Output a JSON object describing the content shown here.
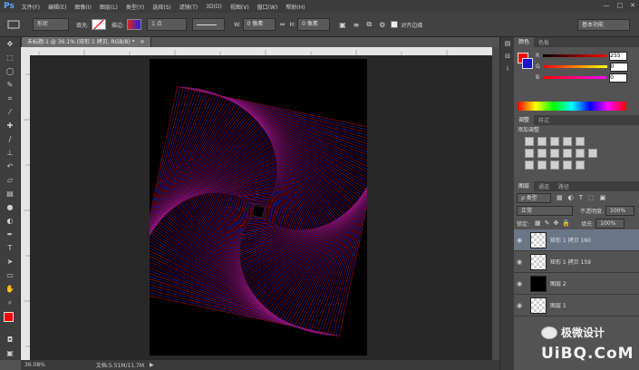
{
  "app": {
    "logo": "Ps"
  },
  "menu": [
    "文件(F)",
    "编辑(E)",
    "图像(I)",
    "图层(L)",
    "类型(Y)",
    "选择(S)",
    "滤镜(T)",
    "3D(D)",
    "视图(V)",
    "窗口(W)",
    "帮助(H)"
  ],
  "window_controls": {
    "minimize": "—",
    "maximize": "□",
    "close": "✕"
  },
  "options": {
    "shape_mode": "形状",
    "fill_label": "填充:",
    "stroke_label": "描边:",
    "stroke_width": "1 点",
    "w_label": "W:",
    "w_value": "0 像素",
    "link_icon": "link-icon",
    "h_label": "H:",
    "h_value": "0 像素",
    "align_edges_label": "对齐边缘",
    "workspace": "基本功能"
  },
  "document": {
    "tab_title": "未标题-1 @ 36.1% (矩形 1 拷贝, RGB/8) *",
    "close": "✕"
  },
  "status": {
    "zoom": "36.08%",
    "doc_info": "文档:5.51M/11.7M"
  },
  "color_panel": {
    "tabs": [
      "颜色",
      "色板"
    ],
    "r_label": "R",
    "r_value": "255",
    "g_label": "G",
    "g_value": "0",
    "b_label": "B",
    "b_value": "0",
    "fg_color": "#ff0000",
    "bg_color": "#1010cc"
  },
  "adjust_panel": {
    "tabs": [
      "调整",
      "样式"
    ],
    "heading": "添加调整"
  },
  "layers_panel": {
    "tabs": [
      "图层",
      "通道",
      "路径"
    ],
    "filter_label": "ρ 类型",
    "blend_mode": "正常",
    "opacity_label": "不透明度:",
    "opacity_value": "100%",
    "lock_label": "锁定:",
    "fill_label": "填充:",
    "fill_value": "100%",
    "layers": [
      {
        "name": "矩形 1 拷贝 160",
        "selected": true
      },
      {
        "name": "矩形 1 拷贝 159",
        "selected": false
      },
      {
        "name": "图层 2",
        "selected": false
      },
      {
        "name": "图层 1",
        "selected": false
      }
    ]
  },
  "watermark": {
    "brand": "极微设计",
    "url": "UiBQ.CoM"
  },
  "colors": {
    "accent_red": "#ff0000",
    "accent_blue": "#2020ff",
    "ui_dark": "#3c3c3c",
    "ui_mid": "#535353"
  }
}
